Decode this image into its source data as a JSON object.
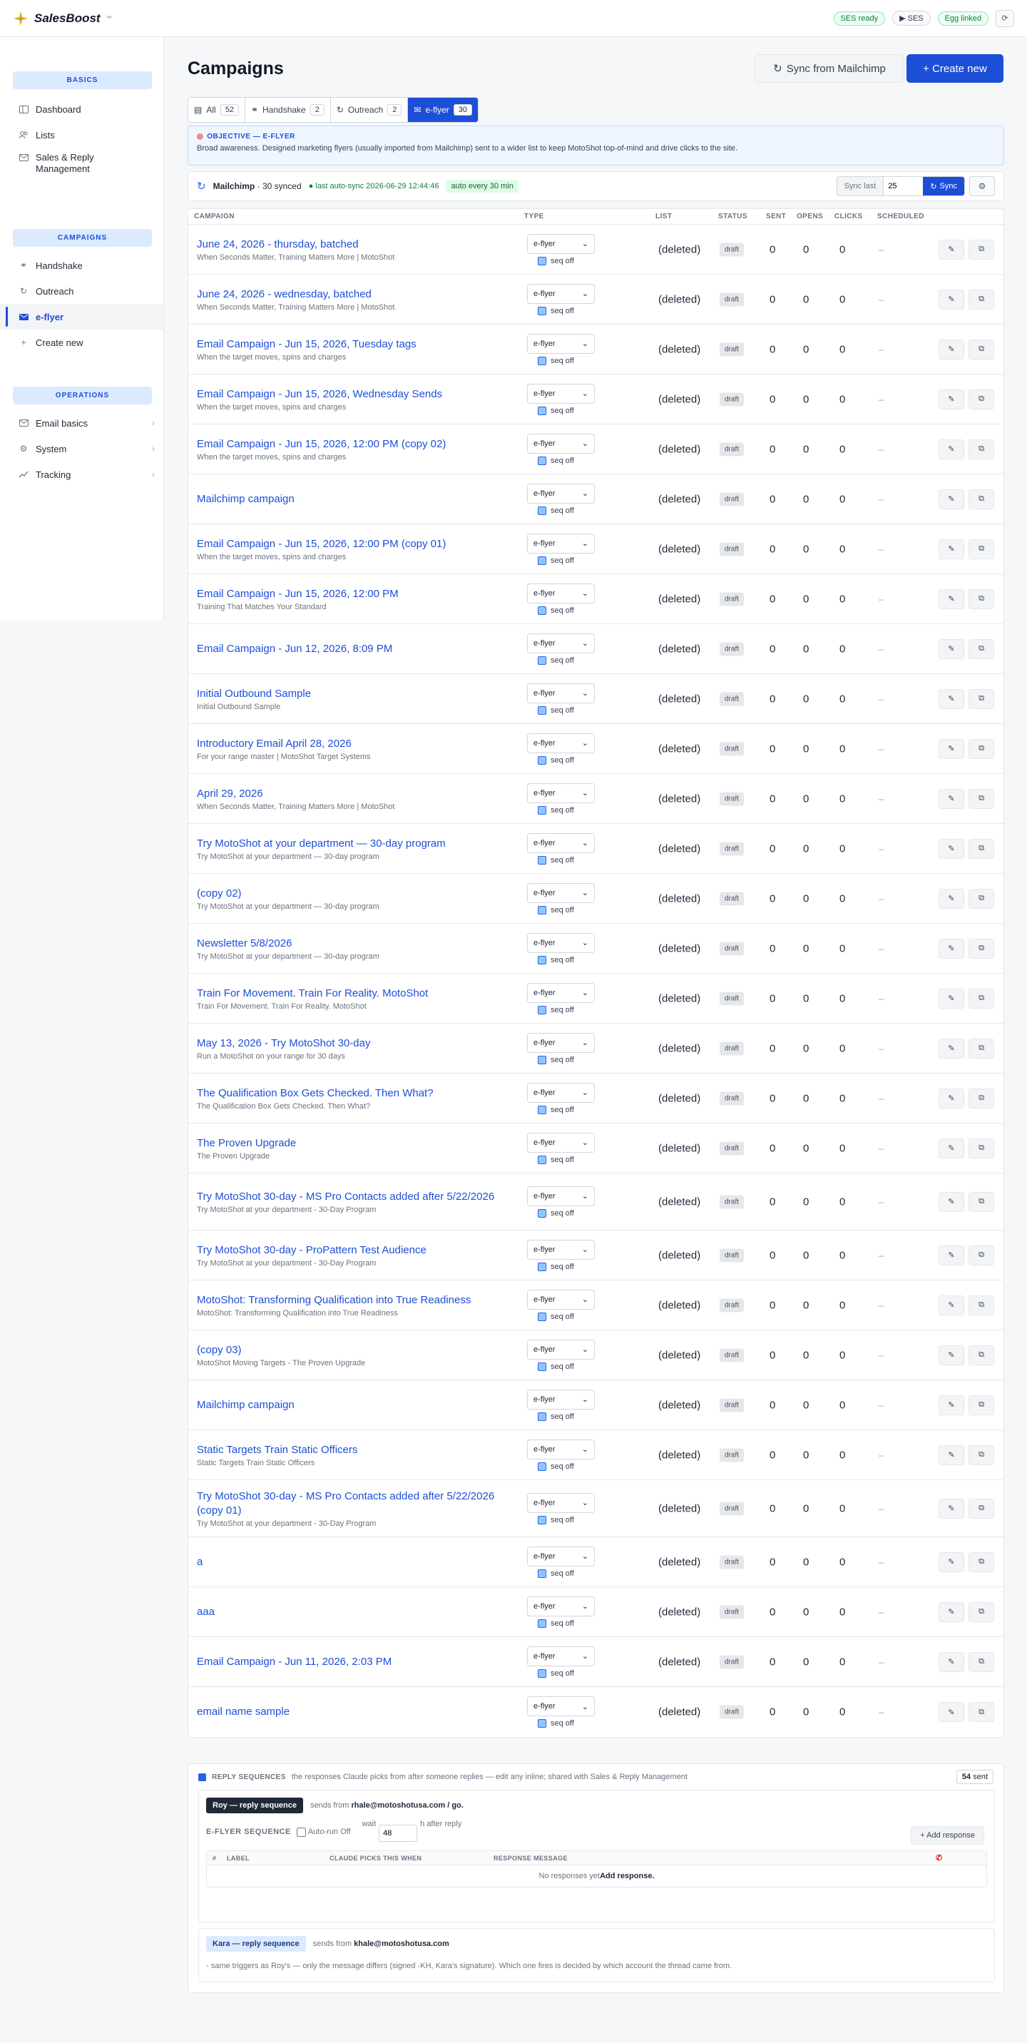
{
  "app": {
    "brand": "SalesBoost",
    "brand_mark": "™"
  },
  "top": {
    "ses_ready": "SES ready",
    "ses": "▶ SES",
    "egg": "Egg linked",
    "refresh": "⟳"
  },
  "sidebar": {
    "basics": "BASICS",
    "basics_items": [
      {
        "label": "Dashboard"
      },
      {
        "label": "Lists"
      },
      {
        "label": "Sales & Reply Management"
      }
    ],
    "campaigns": "CAMPAIGNS",
    "campaign_items": [
      {
        "label": "Handshake"
      },
      {
        "label": "Outreach"
      },
      {
        "label": "e-flyer"
      },
      {
        "label": "Create new"
      }
    ],
    "operations": "OPERATIONS",
    "ops_items": [
      {
        "label": "Email basics"
      },
      {
        "label": "System"
      },
      {
        "label": "Tracking"
      }
    ]
  },
  "page": {
    "title": "Campaigns",
    "sync_mc": "Sync from Mailchimp",
    "create": "+ Create new"
  },
  "tabs": [
    {
      "label": "All",
      "count": "52"
    },
    {
      "label": "Handshake",
      "count": "2"
    },
    {
      "label": "Outreach",
      "count": "2"
    },
    {
      "label": "e-flyer",
      "count": "30"
    }
  ],
  "objective": {
    "heading": "OBJECTIVE — E-FLYER",
    "text": "Broad awareness. Designed marketing flyers (usually imported from Mailchimp) sent to a wider list to keep MotoShot top-of-mind and drive clicks to the site."
  },
  "mailchimp": {
    "name": "Mailchimp",
    "synced": "· 30 synced",
    "last": "last auto-sync 2026-06-29 12:44:46",
    "auto": "auto every 30 min",
    "sync_last": "Sync last",
    "sync_value": "25",
    "sync": "Sync"
  },
  "columns": {
    "campaign": "CAMPAIGN",
    "type": "TYPE",
    "list": "LIST",
    "status": "STATUS",
    "sent": "SENT",
    "opens": "OPENS",
    "clicks": "CLICKS",
    "scheduled": "SCHEDULED"
  },
  "row_defaults": {
    "type": "e-flyer",
    "seq": "seq off",
    "list": "(deleted)",
    "status": "draft",
    "sent": "0",
    "opens": "0",
    "clicks": "0",
    "scheduled": "–"
  },
  "campaigns": [
    {
      "title": "June 24, 2026 - thursday, batched",
      "subtitle": "When Seconds Matter, Training Matters More | MotoShot"
    },
    {
      "title": "June 24, 2026 - wednesday, batched",
      "subtitle": "When Seconds Matter, Training Matters More | MotoShot"
    },
    {
      "title": "Email Campaign - Jun 15, 2026, Tuesday tags",
      "subtitle": "When the target moves, spins and charges"
    },
    {
      "title": "Email Campaign - Jun 15, 2026, Wednesday Sends",
      "subtitle": "When the target moves, spins and charges"
    },
    {
      "title": "Email Campaign - Jun 15, 2026, 12:00 PM (copy 02)",
      "subtitle": "When the target moves, spins and charges"
    },
    {
      "title": "Mailchimp campaign",
      "subtitle": ""
    },
    {
      "title": "Email Campaign - Jun 15, 2026, 12:00 PM (copy 01)",
      "subtitle": "When the target moves, spins and charges"
    },
    {
      "title": "Email Campaign - Jun 15, 2026, 12:00 PM",
      "subtitle": "Training That Matches Your Standard"
    },
    {
      "title": "Email Campaign - Jun 12, 2026, 8:09 PM",
      "subtitle": ""
    },
    {
      "title": "Initial Outbound Sample",
      "subtitle": "Initial Outbound Sample"
    },
    {
      "title": "Introductory Email April 28, 2026",
      "subtitle": "For your range master | MotoShot Target Systems"
    },
    {
      "title": "April 29, 2026",
      "subtitle": "When Seconds Matter, Training Matters More | MotoShot"
    },
    {
      "title": "Try MotoShot at your department — 30-day program",
      "subtitle": "Try MotoShot at your department — 30-day program"
    },
    {
      "title": "(copy 02)",
      "subtitle": "Try MotoShot at your department — 30-day program"
    },
    {
      "title": "Newsletter 5/8/2026",
      "subtitle": "Try MotoShot at your department — 30-day program"
    },
    {
      "title": "Train For Movement. Train For Reality. MotoShot",
      "subtitle": "Train For Movement. Train For Reality. MotoShot"
    },
    {
      "title": "May 13, 2026 - Try MotoShot 30-day",
      "subtitle": "Run a MotoShot on your range for 30 days"
    },
    {
      "title": "The Qualification Box Gets Checked. Then What?",
      "subtitle": "The Qualification Box Gets Checked. Then What?"
    },
    {
      "title": "The Proven Upgrade",
      "subtitle": "The Proven Upgrade"
    },
    {
      "title": "Try MotoShot 30-day - MS Pro Contacts added after 5/22/2026",
      "subtitle": "Try MotoShot at your department - 30-Day Program",
      "tall": true
    },
    {
      "title": "Try MotoShot 30-day - ProPattern Test Audience",
      "subtitle": "Try MotoShot at your department - 30-Day Program"
    },
    {
      "title": "MotoShot: Transforming Qualification into True Readiness",
      "subtitle": "MotoShot: Transforming Qualification into True Readiness"
    },
    {
      "title": "(copy 03)",
      "subtitle": "MotoShot Moving Targets - The Proven Upgrade"
    },
    {
      "title": "Mailchimp campaign",
      "subtitle": ""
    },
    {
      "title": "Static Targets Train Static Officers",
      "subtitle": "Static Targets Train Static Officers"
    },
    {
      "title": "Try MotoShot 30-day - MS Pro Contacts added after 5/22/2026 (copy 01)",
      "subtitle": "Try MotoShot at your department - 30-Day Program",
      "tall": true
    },
    {
      "title": "a",
      "subtitle": ""
    },
    {
      "title": "aaa",
      "subtitle": ""
    },
    {
      "title": "Email Campaign - Jun 11, 2026, 2:03 PM",
      "subtitle": ""
    },
    {
      "title": "email name sample",
      "subtitle": ""
    }
  ],
  "replies": {
    "heading": "REPLY SEQUENCES",
    "desc": "the responses Claude picks from after someone replies — edit any inline; shared with Sales & Reply Management",
    "sent_count": "54",
    "sent_label": "sent",
    "roy_tag": "Roy — reply sequence",
    "roy_from_pre": "sends from",
    "roy_from": "rhale@motoshotusa.com / go.",
    "seq_label": "E-FLYER SEQUENCE",
    "autorun": "Auto-run Off",
    "wait": "wait",
    "wait_value": "48",
    "after": "h after reply",
    "add": "+ Add response",
    "cols": {
      "num": "#",
      "label": "LABEL",
      "when": "CLAUDE PICKS THIS WHEN",
      "msg": "RESPONSE MESSAGE"
    },
    "empty": "No responses yet",
    "empty_link": "Add response.",
    "kara_tag": "Kara — reply sequence",
    "kara_from_pre": "sends from",
    "kara_from": "khale@motoshotusa.com",
    "kara_note": "- same triggers as Roy's — only the message differs (signed -KH, Kara's signature). Which one fires is decided by which account the thread came from."
  }
}
